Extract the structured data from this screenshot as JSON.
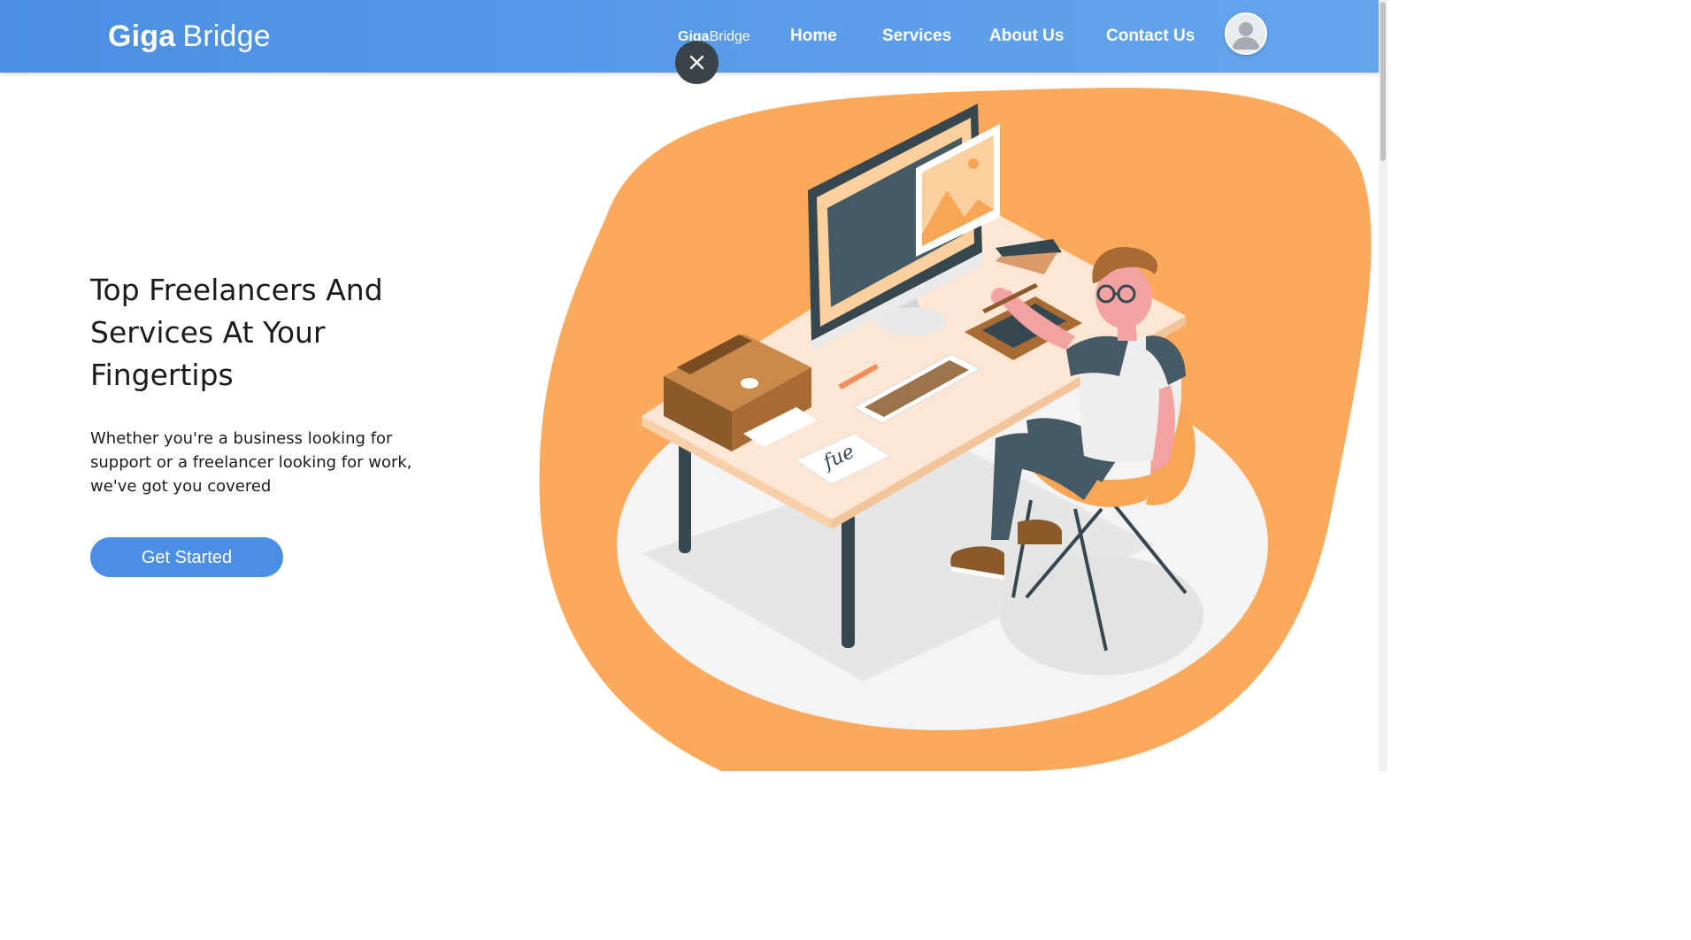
{
  "header": {
    "brand_bold": "Giga",
    "brand_regular": "Bridge",
    "nav_logo_bold": "Giga",
    "nav_logo_regular": "Bridge",
    "nav": [
      {
        "label": "Home"
      },
      {
        "label": "Services"
      },
      {
        "label": "About Us"
      },
      {
        "label": "Contact Us"
      }
    ],
    "avatar_icon": "user-avatar-icon",
    "close_icon": "close-icon"
  },
  "hero": {
    "title": "Top Freelancers And Services At Your Fingertips",
    "subtitle": "Whether you're a business looking for support or a freelancer looking for work, we've got you covered",
    "cta_label": "Get Started"
  },
  "illustration": {
    "note_text": "fue"
  },
  "colors": {
    "header_blue": "#4a8fe4",
    "accent_orange": "#fda95b",
    "close_button": "#3b4248"
  }
}
